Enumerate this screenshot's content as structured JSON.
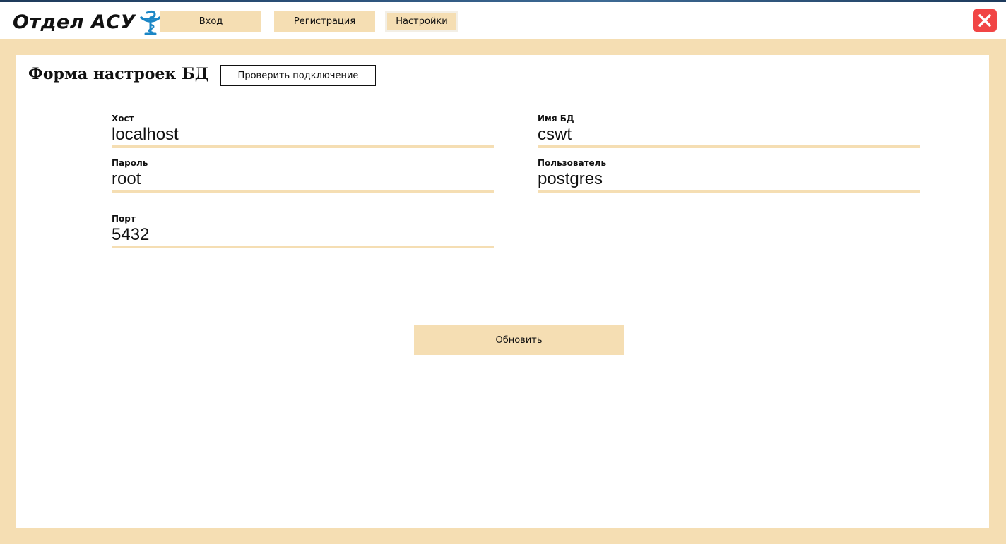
{
  "app": {
    "logo_text": "Отдел АСУ",
    "logo_icon": "pharmacy-bowl-snake-icon"
  },
  "nav": {
    "login_label": "Вход",
    "register_label": "Регистрация",
    "settings_label": "Настройки",
    "close_icon": "close-icon"
  },
  "form": {
    "title": "Форма настроек БД",
    "check_button_label": "Проверить подключение",
    "fields": {
      "host": {
        "label": "Хост",
        "value": "localhost"
      },
      "db_name": {
        "label": "Имя БД",
        "value": "cswt"
      },
      "password": {
        "label": "Пароль",
        "value": "root"
      },
      "user": {
        "label": "Пользователь",
        "value": "postgres"
      },
      "port": {
        "label": "Порт",
        "value": "5432"
      }
    },
    "update_button_label": "Обновить"
  },
  "colors": {
    "accent": "#f5deb3",
    "close_button": "#f14545",
    "logo_icon": "#1b86c6"
  }
}
